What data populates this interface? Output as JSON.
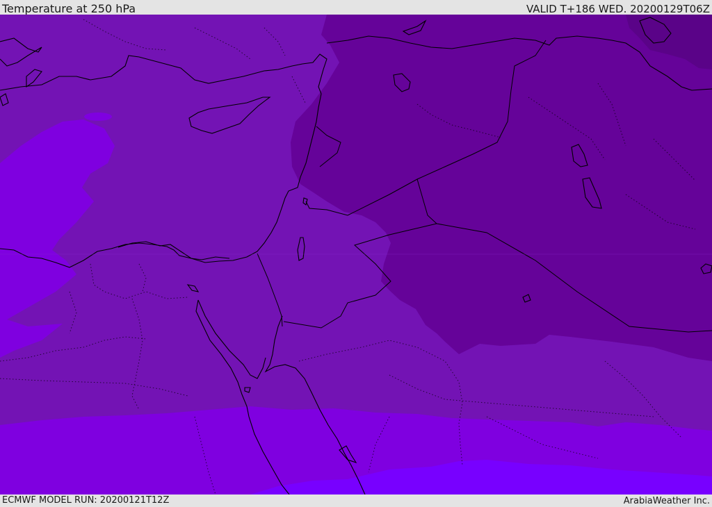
{
  "header": {
    "title": "Temperature at 250 hPa",
    "valid": "VALID T+186 WED. 20200129T06Z"
  },
  "footer": {
    "model_run": "ECMWF MODEL RUN: 20200121T12Z",
    "credit": "ArabiaWeather Inc."
  },
  "map": {
    "region": "Eastern Mediterranean / Middle East",
    "colors": {
      "base_purple": "#7313b4",
      "dark_purple": "#650399",
      "darkest_purple": "#5a0388",
      "bright_violet": "#7f00e0",
      "brightest_violet": "#7800ff",
      "coastline": "#000000",
      "border": "#000000"
    }
  }
}
